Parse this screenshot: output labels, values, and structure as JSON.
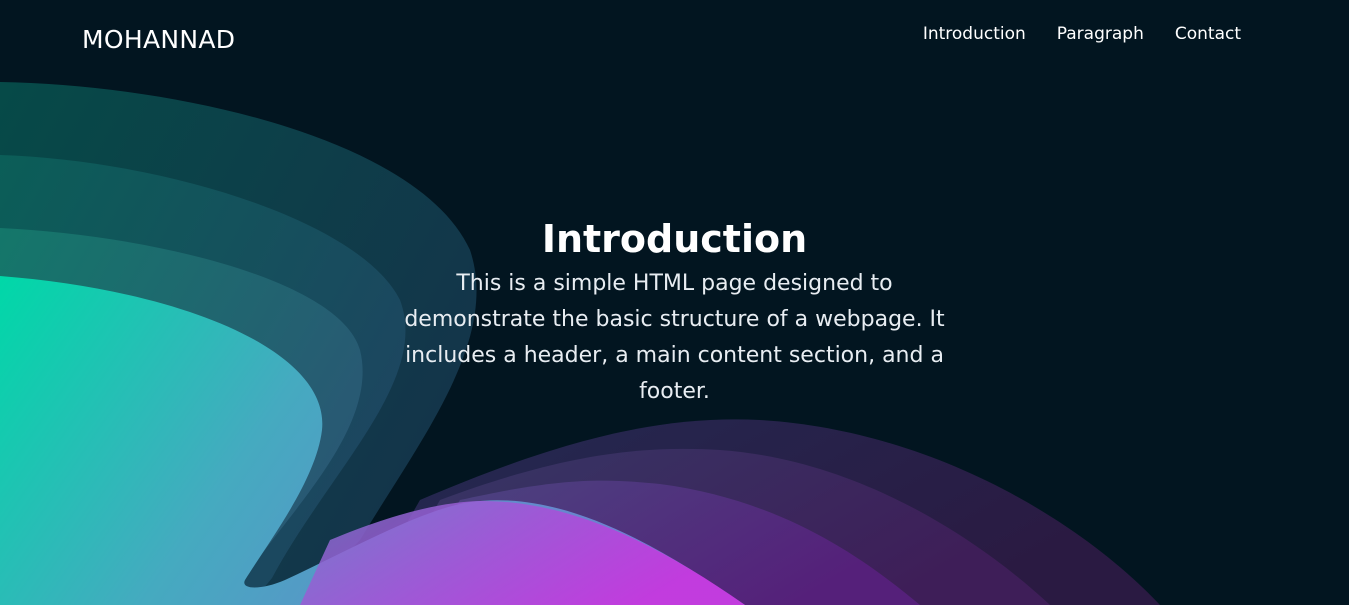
{
  "header": {
    "logo": "MOHANNAD",
    "nav": [
      {
        "label": "Introduction"
      },
      {
        "label": "Paragraph"
      },
      {
        "label": "Contact"
      }
    ]
  },
  "hero": {
    "title": "Introduction",
    "text": "This is a simple HTML page designed to demonstrate the basic structure of a webpage. It includes a header, a main content section, and a footer."
  },
  "colors": {
    "background": "#021520",
    "wave_teal": "#00e3b0",
    "wave_blue": "#5a8cc8",
    "wave_magenta": "#c838e0",
    "text": "#ffffff"
  }
}
